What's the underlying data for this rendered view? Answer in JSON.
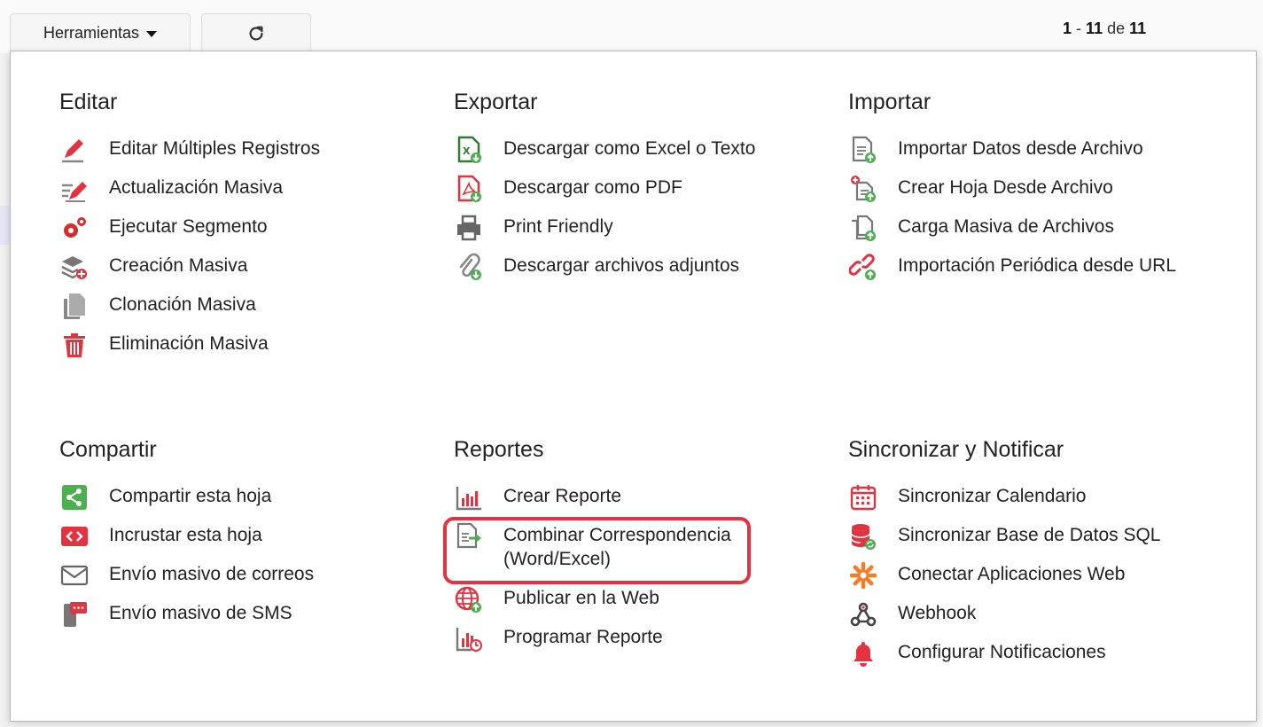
{
  "toolbar": {
    "tools_label": "Herramientas",
    "refresh_icon": "refresh-icon",
    "pager_start": "1",
    "pager_sep": "-",
    "pager_end": "11",
    "pager_of": "de",
    "pager_total": "11"
  },
  "sections": {
    "editar": {
      "title": "Editar",
      "items": [
        {
          "label": "Editar Múltiples Registros",
          "icon": "pencil-icon"
        },
        {
          "label": "Actualización Masiva",
          "icon": "bulk-edit-icon"
        },
        {
          "label": "Ejecutar Segmento",
          "icon": "gears-icon"
        },
        {
          "label": "Creación Masiva",
          "icon": "layers-add-icon"
        },
        {
          "label": "Clonación Masiva",
          "icon": "copy-icon"
        },
        {
          "label": "Eliminación Masiva",
          "icon": "trash-icon"
        }
      ]
    },
    "exportar": {
      "title": "Exportar",
      "items": [
        {
          "label": "Descargar como Excel o Texto",
          "icon": "excel-download-icon"
        },
        {
          "label": "Descargar como PDF",
          "icon": "pdf-download-icon"
        },
        {
          "label": "Print Friendly",
          "icon": "printer-icon"
        },
        {
          "label": "Descargar archivos adjuntos",
          "icon": "attachment-download-icon"
        }
      ]
    },
    "importar": {
      "title": "Importar",
      "items": [
        {
          "label": "Importar Datos desde Archivo",
          "icon": "file-import-icon"
        },
        {
          "label": "Crear Hoja Desde Archivo",
          "icon": "sheet-from-file-icon"
        },
        {
          "label": "Carga Masiva de Archivos",
          "icon": "bulk-upload-icon"
        },
        {
          "label": "Importación Periódica desde URL",
          "icon": "link-import-icon"
        }
      ]
    },
    "compartir": {
      "title": "Compartir",
      "items": [
        {
          "label": "Compartir esta hoja",
          "icon": "share-icon"
        },
        {
          "label": "Incrustar esta hoja",
          "icon": "embed-icon"
        },
        {
          "label": "Envío masivo de correos",
          "icon": "envelope-icon"
        },
        {
          "label": "Envío masivo de SMS",
          "icon": "sms-icon"
        }
      ]
    },
    "reportes": {
      "title": "Reportes",
      "items": [
        {
          "label": "Crear Reporte",
          "icon": "bar-chart-icon"
        },
        {
          "label": "Combinar Correspondencia (Word/Excel)",
          "icon": "mail-merge-icon"
        },
        {
          "label": "Publicar en la Web",
          "icon": "globe-icon"
        },
        {
          "label": "Programar Reporte",
          "icon": "schedule-report-icon"
        }
      ]
    },
    "sincronizar": {
      "title": "Sincronizar y Notificar",
      "items": [
        {
          "label": "Sincronizar Calendario",
          "icon": "calendar-icon"
        },
        {
          "label": "Sincronizar Base de Datos SQL",
          "icon": "database-icon"
        },
        {
          "label": "Conectar Aplicaciones Web",
          "icon": "zapier-icon"
        },
        {
          "label": "Webhook",
          "icon": "webhook-icon"
        },
        {
          "label": "Configurar Notificaciones",
          "icon": "bell-icon"
        }
      ]
    }
  },
  "colors": {
    "red": "#e43340",
    "green": "#4caf50",
    "gray": "#666666",
    "orange": "#f57c22"
  }
}
